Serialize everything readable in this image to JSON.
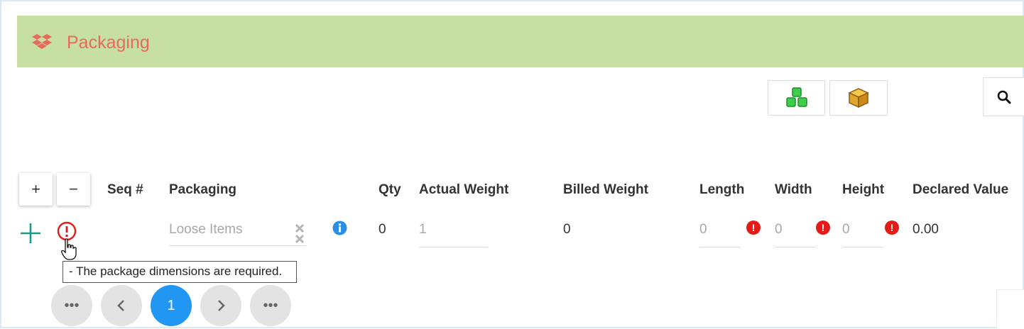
{
  "header": {
    "title": "Packaging",
    "icon": "dropbox-box-icon",
    "title_color": "#e96a5a",
    "background": "#c6e0a4"
  },
  "toolbar": {
    "buttons": [
      "green-cubes-icon",
      "yellow-box-icon",
      "search-icon"
    ]
  },
  "row_controls": {
    "plus": "+",
    "minus": "−"
  },
  "columns": [
    "Seq #",
    "Packaging",
    "Qty",
    "Actual Weight",
    "Billed Weight",
    "Length",
    "Width",
    "Height",
    "Declared Value"
  ],
  "row": {
    "packaging_placeholder": "Loose Items",
    "qty": "0",
    "actual_weight": "1",
    "billed_weight": "0",
    "length_placeholder": "0",
    "width_placeholder": "0",
    "height_placeholder": "0",
    "declared_value": "0.00"
  },
  "tooltip": "- The package dimensions are required.",
  "pagination": {
    "first": "•••",
    "prev": "‹",
    "current": "1",
    "next": "›",
    "last": "•••"
  },
  "colors": {
    "accent": "#2196f3",
    "error": "#e41b17",
    "add": "#1a9a8a"
  }
}
